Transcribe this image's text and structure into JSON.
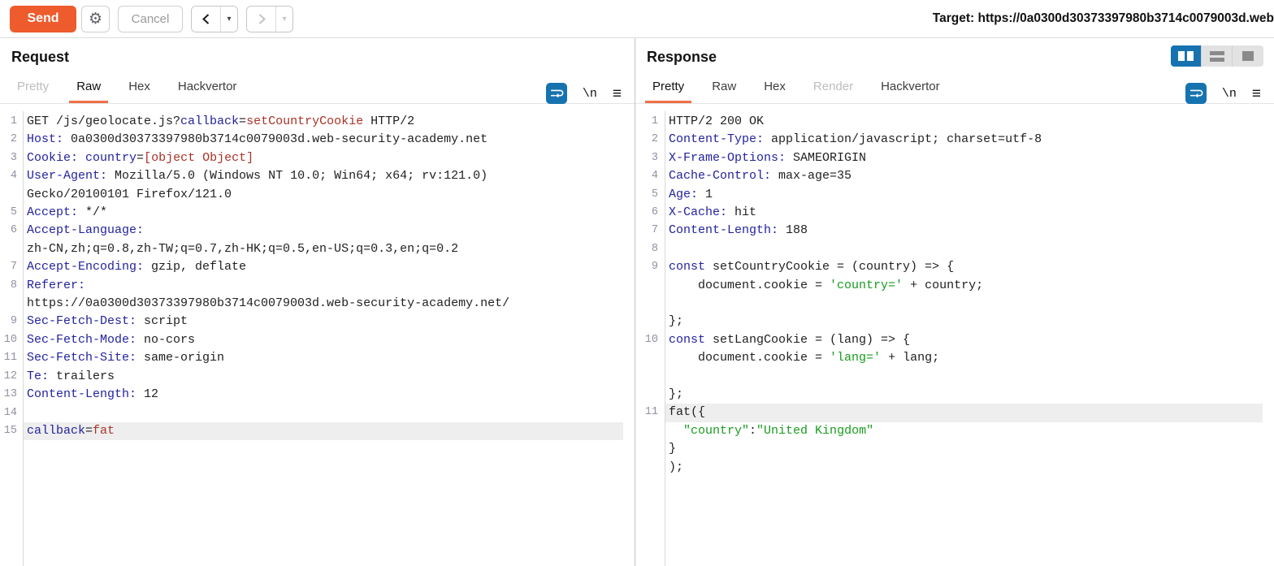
{
  "toolbar": {
    "send_label": "Send",
    "cancel_label": "Cancel",
    "target_label": "Target:",
    "target_url": "https://0a0300d30373397980b3714c0079003d.web"
  },
  "icons": {
    "gear": "⚙",
    "newline_label": "\\n",
    "menu": "≡",
    "dropdown": "▾"
  },
  "colors": {
    "accent_orange": "#ee5b2c",
    "tab_underline": "#f0714a",
    "burp_blue": "#1673b0",
    "syntax_header_blue": "#23239f",
    "syntax_value_red": "#a93226",
    "syntax_string_green": "#189c1e",
    "line_highlight": "#eeeeee",
    "line_number_grey": "#9191a3"
  },
  "request": {
    "title": "Request",
    "tabs": [
      {
        "label": "Pretty",
        "state": "disabled"
      },
      {
        "label": "Raw",
        "state": "selected"
      },
      {
        "label": "Hex",
        "state": "normal"
      },
      {
        "label": "Hackvertor",
        "state": "normal"
      }
    ],
    "rows": [
      {
        "n": "1",
        "seg": [
          [
            "d",
            "GET /js/geolocate.js?"
          ],
          [
            "b",
            "callback"
          ],
          [
            "d",
            "="
          ],
          [
            "r",
            "setCountryCookie"
          ],
          [
            "d",
            " HTTP/2"
          ]
        ]
      },
      {
        "n": "2",
        "seg": [
          [
            "b",
            "Host:"
          ],
          [
            "d",
            " 0a0300d30373397980b3714c0079003d.web-security-academy.net"
          ]
        ]
      },
      {
        "n": "3",
        "seg": [
          [
            "b",
            "Cookie:"
          ],
          [
            "d",
            " "
          ],
          [
            "b",
            "country"
          ],
          [
            "d",
            "="
          ],
          [
            "r",
            "[object Object]"
          ]
        ]
      },
      {
        "n": "4",
        "seg": [
          [
            "b",
            "User-Agent:"
          ],
          [
            "d",
            " Mozilla/5.0 (Windows NT 10.0; Win64; x64; rv:121.0)"
          ]
        ]
      },
      {
        "n": "",
        "seg": [
          [
            "d",
            "Gecko/20100101 Firefox/121.0"
          ]
        ]
      },
      {
        "n": "5",
        "seg": [
          [
            "b",
            "Accept:"
          ],
          [
            "d",
            " */*"
          ]
        ]
      },
      {
        "n": "6",
        "seg": [
          [
            "b",
            "Accept-Language:"
          ]
        ]
      },
      {
        "n": "",
        "seg": [
          [
            "d",
            "zh-CN,zh;q=0.8,zh-TW;q=0.7,zh-HK;q=0.5,en-US;q=0.3,en;q=0.2"
          ]
        ]
      },
      {
        "n": "7",
        "seg": [
          [
            "b",
            "Accept-Encoding:"
          ],
          [
            "d",
            " gzip, deflate"
          ]
        ]
      },
      {
        "n": "8",
        "seg": [
          [
            "b",
            "Referer:"
          ]
        ]
      },
      {
        "n": "",
        "seg": [
          [
            "d",
            "https://0a0300d30373397980b3714c0079003d.web-security-academy.net/"
          ]
        ]
      },
      {
        "n": "9",
        "seg": [
          [
            "b",
            "Sec-Fetch-Dest:"
          ],
          [
            "d",
            " script"
          ]
        ]
      },
      {
        "n": "10",
        "seg": [
          [
            "b",
            "Sec-Fetch-Mode:"
          ],
          [
            "d",
            " no-cors"
          ]
        ]
      },
      {
        "n": "11",
        "seg": [
          [
            "b",
            "Sec-Fetch-Site:"
          ],
          [
            "d",
            " same-origin"
          ]
        ]
      },
      {
        "n": "12",
        "seg": [
          [
            "b",
            "Te:"
          ],
          [
            "d",
            " trailers"
          ]
        ]
      },
      {
        "n": "13",
        "seg": [
          [
            "b",
            "Content-Length:"
          ],
          [
            "d",
            " 12"
          ]
        ]
      },
      {
        "n": "14",
        "seg": []
      },
      {
        "n": "15",
        "hl": true,
        "seg": [
          [
            "b",
            "callback"
          ],
          [
            "d",
            "="
          ],
          [
            "r",
            "fat"
          ]
        ]
      }
    ]
  },
  "response": {
    "title": "Response",
    "tabs": [
      {
        "label": "Pretty",
        "state": "selected"
      },
      {
        "label": "Raw",
        "state": "normal"
      },
      {
        "label": "Hex",
        "state": "normal"
      },
      {
        "label": "Render",
        "state": "disabled"
      },
      {
        "label": "Hackvertor",
        "state": "normal"
      }
    ],
    "rows": [
      {
        "n": "1",
        "seg": [
          [
            "d",
            "HTTP/2 200 OK"
          ]
        ]
      },
      {
        "n": "2",
        "seg": [
          [
            "b",
            "Content-Type:"
          ],
          [
            "d",
            " application/javascript; charset=utf-8"
          ]
        ]
      },
      {
        "n": "3",
        "seg": [
          [
            "b",
            "X-Frame-Options:"
          ],
          [
            "d",
            " SAMEORIGIN"
          ]
        ]
      },
      {
        "n": "4",
        "seg": [
          [
            "b",
            "Cache-Control:"
          ],
          [
            "d",
            " max-age=35"
          ]
        ]
      },
      {
        "n": "5",
        "seg": [
          [
            "b",
            "Age:"
          ],
          [
            "d",
            " 1"
          ]
        ]
      },
      {
        "n": "6",
        "seg": [
          [
            "b",
            "X-Cache:"
          ],
          [
            "d",
            " hit"
          ]
        ]
      },
      {
        "n": "7",
        "seg": [
          [
            "b",
            "Content-Length:"
          ],
          [
            "d",
            " 188"
          ]
        ]
      },
      {
        "n": "8",
        "seg": []
      },
      {
        "n": "9",
        "seg": [
          [
            "b",
            "const"
          ],
          [
            "d",
            " setCountryCookie = (country) => {"
          ]
        ]
      },
      {
        "n": "",
        "seg": [
          [
            "d",
            "    document.cookie = "
          ],
          [
            "g",
            "'country='"
          ],
          [
            "d",
            " + country;"
          ]
        ]
      },
      {
        "n": "",
        "seg": []
      },
      {
        "n": "",
        "seg": [
          [
            "d",
            "};"
          ]
        ]
      },
      {
        "n": "10",
        "seg": [
          [
            "b",
            "const"
          ],
          [
            "d",
            " setLangCookie = (lang) => {"
          ]
        ]
      },
      {
        "n": "",
        "seg": [
          [
            "d",
            "    document.cookie = "
          ],
          [
            "g",
            "'lang='"
          ],
          [
            "d",
            " + lang;"
          ]
        ]
      },
      {
        "n": "",
        "seg": []
      },
      {
        "n": "",
        "seg": [
          [
            "d",
            "};"
          ]
        ]
      },
      {
        "n": "11",
        "hl": true,
        "seg": [
          [
            "d",
            "fat({"
          ]
        ]
      },
      {
        "n": "",
        "seg": [
          [
            "d",
            "  "
          ],
          [
            "g",
            "\"country\""
          ],
          [
            "d",
            ":"
          ],
          [
            "g",
            "\"United Kingdom\""
          ]
        ]
      },
      {
        "n": "",
        "seg": [
          [
            "d",
            "}"
          ]
        ]
      },
      {
        "n": "",
        "seg": [
          [
            "d",
            ");"
          ]
        ]
      }
    ]
  }
}
